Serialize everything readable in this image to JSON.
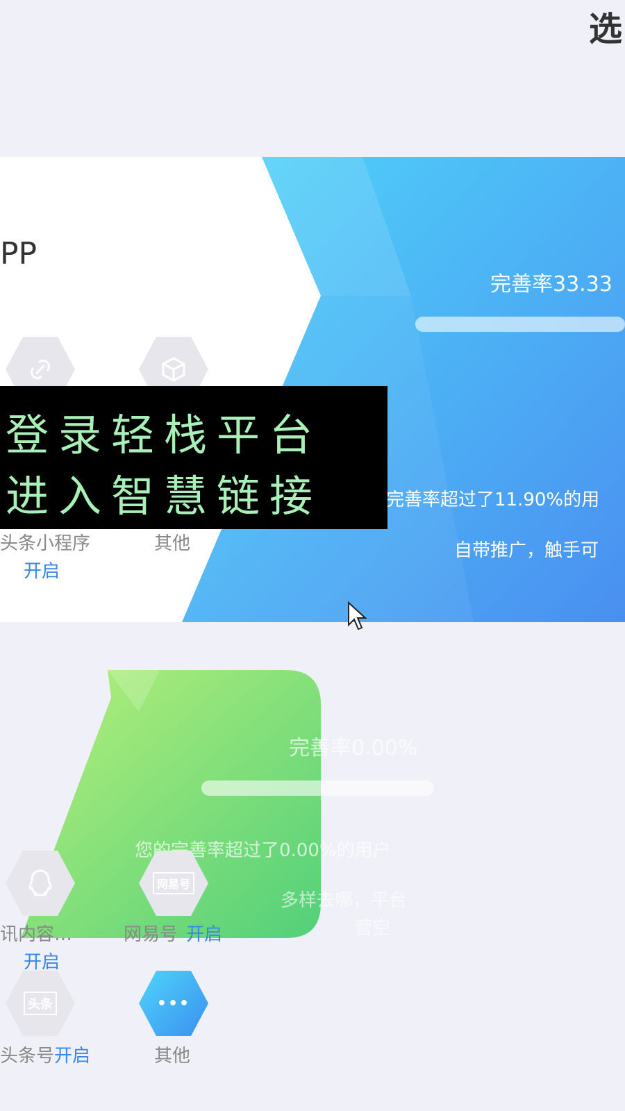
{
  "header": {
    "title_fragment": "选"
  },
  "card_app": {
    "title_fragment": "PP",
    "completion": "完善率33.33",
    "exceeded": "完善率超过了11.90%的用",
    "slogan": "自带推广，触手可",
    "items": [
      {
        "label": "头条小程序",
        "status": "开启",
        "icon": "link-icon"
      },
      {
        "label": "其他",
        "icon": "cube-icon"
      }
    ]
  },
  "overlay": {
    "line1": "登录轻栈平台",
    "line2": "进入智慧链接"
  },
  "card_content": {
    "completion": "完善率0.00%",
    "exceeded": "您的完善率超过了0.00%的用户",
    "slogan_line1": "多样去哪，平台",
    "slogan_line2": "营空",
    "items": [
      {
        "label": "讯内容…",
        "status": "开启",
        "icon": "qq-icon"
      },
      {
        "label": "网易号",
        "status": "开启",
        "icon": "netease-icon",
        "icon_text": "网易号"
      },
      {
        "label": "头条号",
        "status": "开启",
        "icon": "toutiao-icon",
        "icon_text": "头条"
      },
      {
        "label": "其他",
        "icon": "more-icon",
        "icon_text": "•••"
      }
    ]
  },
  "colors": {
    "blue_start": "#4fd6fa",
    "blue_end": "#4a8ff0",
    "green_start": "#b8f07a",
    "green_end": "#52d07a",
    "accent": "#3a86e8"
  }
}
